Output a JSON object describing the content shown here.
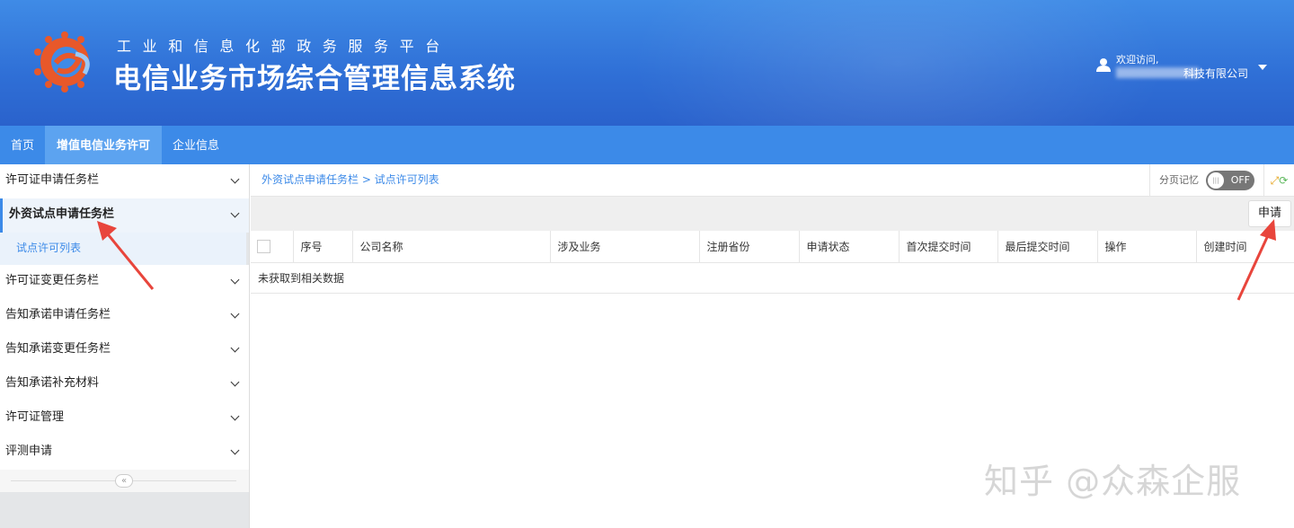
{
  "header": {
    "subtitle": "工业和信息化部政务服务平台",
    "title": "电信业务市场综合管理信息系统",
    "welcome": "欢迎访问,",
    "company": "科技有限公司"
  },
  "nav": [
    "首页",
    "增值电信业务许可",
    "企业信息"
  ],
  "sidebar": {
    "items": [
      {
        "label": "许可证申请任务栏"
      },
      {
        "label": "外资试点申请任务栏",
        "active": true,
        "children": [
          "试点许可列表"
        ]
      },
      {
        "label": "许可证变更任务栏"
      },
      {
        "label": "告知承诺申请任务栏"
      },
      {
        "label": "告知承诺变更任务栏"
      },
      {
        "label": "告知承诺补充材料"
      },
      {
        "label": "许可证管理"
      },
      {
        "label": "评测申请"
      }
    ],
    "collapse": "«"
  },
  "breadcrumb": "外资试点申请任务栏 > 试点许可列表",
  "tools": {
    "page_memory": "分页记忆",
    "toggle_state": "OFF"
  },
  "apply_button": "申请",
  "table": {
    "columns": [
      "序号",
      "公司名称",
      "涉及业务",
      "注册省份",
      "申请状态",
      "首次提交时间",
      "最后提交时间",
      "操作",
      "创建时间"
    ],
    "empty": "未获取到相关数据"
  },
  "watermark": "知乎 @众森企服",
  "colors": {
    "header": "#2f6fd6",
    "nav": "#3c8ae8",
    "arrow": "#e8453c"
  }
}
